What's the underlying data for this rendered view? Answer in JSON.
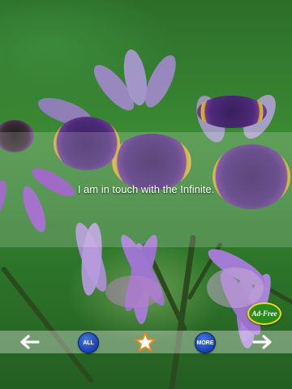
{
  "quote": {
    "text": "I am in touch with the Infinite."
  },
  "toolbar": {
    "prev_icon": "left-arrow-icon",
    "all_label": "ALL",
    "favorite_icon": "star-icon",
    "more_label": "MORE",
    "next_icon": "right-arrow-icon"
  },
  "badge": {
    "label": "Ad-Free"
  },
  "colors": {
    "background_green": "#2f7a2c",
    "petal_purple": "#9b6fc9",
    "flower_center": "#4c2a78",
    "pollen_yellow": "#e6c23e",
    "button_blue": "#1d47b8",
    "star_orange": "#e98a1a",
    "badge_green": "#2a8a1d",
    "badge_border": "#f0e000"
  }
}
